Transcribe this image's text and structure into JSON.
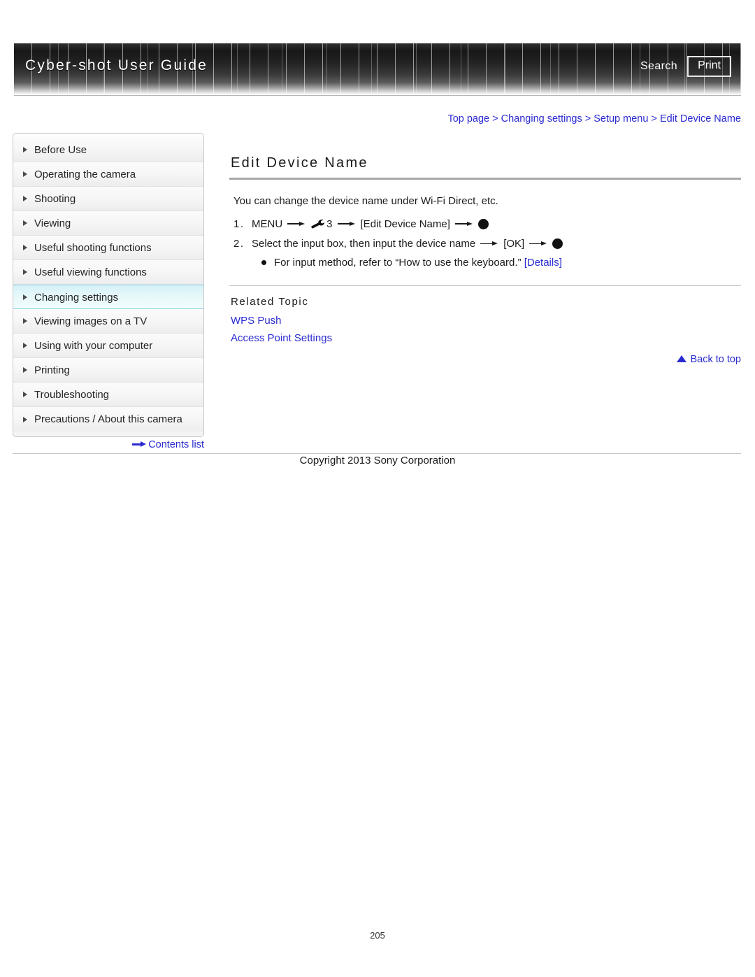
{
  "header": {
    "site_title": "Cyber-shot User Guide",
    "search_label": "Search",
    "print_label": "Print"
  },
  "breadcrumb": {
    "items": [
      "Top page",
      "Changing settings",
      "Setup menu",
      "Edit Device Name"
    ],
    "separator": ">",
    "full_text": "Top page > Changing settings > Setup menu > Edit Device Name"
  },
  "sidebar": {
    "items": [
      {
        "label": "Before Use",
        "active": false
      },
      {
        "label": "Operating the camera",
        "active": false
      },
      {
        "label": "Shooting",
        "active": false
      },
      {
        "label": "Viewing",
        "active": false
      },
      {
        "label": "Useful shooting functions",
        "active": false
      },
      {
        "label": "Useful viewing functions",
        "active": false
      },
      {
        "label": "Changing settings",
        "active": true
      },
      {
        "label": "Viewing images on a TV",
        "active": false
      },
      {
        "label": "Using with your computer",
        "active": false
      },
      {
        "label": "Printing",
        "active": false
      },
      {
        "label": "Troubleshooting",
        "active": false
      },
      {
        "label": "Precautions / About this camera",
        "active": false
      }
    ],
    "contents_list_label": "Contents list"
  },
  "main": {
    "title": "Edit Device Name",
    "intro": "You can change the device name under Wi-Fi Direct, etc.",
    "steps": [
      {
        "num": "1.",
        "seg1": "MENU",
        "menu_number": "3",
        "seg2": "[Edit Device Name]",
        "icon": "wrench-icon",
        "end_icon": "center-button-dot-icon"
      },
      {
        "num": "2.",
        "seg1": "Select the input box, then input the device name",
        "seg2": "[OK]",
        "end_icon": "center-button-dot-icon"
      }
    ],
    "sub_note": {
      "text": "For input method, refer to “How to use the keyboard.”",
      "link": "[Details]"
    },
    "related": {
      "heading": "Related Topic",
      "links": [
        "WPS Push",
        "Access Point Settings"
      ]
    },
    "back_to_top": "Back to top"
  },
  "footer": {
    "copyright": "Copyright 2013 Sony Corporation",
    "page_number": "205"
  },
  "colors": {
    "link": "#2a2ad0",
    "active_nav": "#d4f1f7",
    "header_dark": "#171717"
  }
}
